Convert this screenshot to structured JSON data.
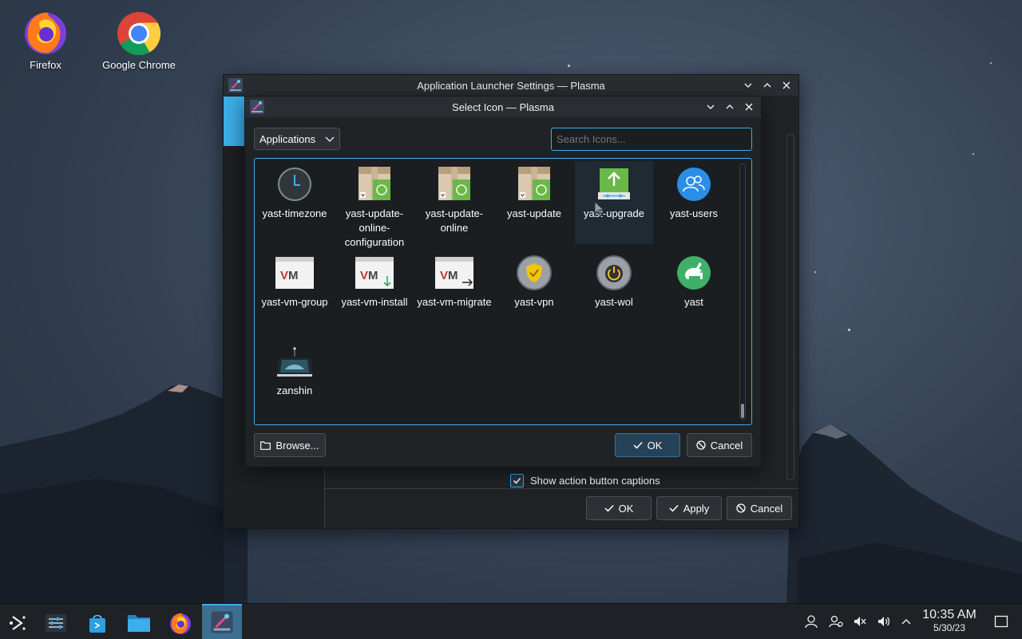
{
  "desktop": {
    "icons": [
      {
        "label": "Firefox"
      },
      {
        "label": "Google Chrome"
      }
    ]
  },
  "launcher_window": {
    "title": "Application Launcher Settings — Plasma",
    "show_captions_label": "Show action button captions",
    "show_captions_checked": true,
    "ok_label": "OK",
    "apply_label": "Apply",
    "cancel_label": "Cancel"
  },
  "dialog": {
    "title": "Select Icon — Plasma",
    "category": "Applications",
    "search_placeholder": "Search Icons...",
    "icons": [
      {
        "label": "yast-timezone",
        "icon": "clock-icon"
      },
      {
        "label": "yast-update-online-configuration",
        "icon": "package-update-icon"
      },
      {
        "label": "yast-update-online",
        "icon": "package-update-icon"
      },
      {
        "label": "yast-update",
        "icon": "package-update-icon"
      },
      {
        "label": "yast-upgrade",
        "icon": "upgrade-arrow-icon"
      },
      {
        "label": "yast-users",
        "icon": "users-icon"
      },
      {
        "label": "yast-vm-group",
        "icon": "vm-window-icon"
      },
      {
        "label": "yast-vm-install",
        "icon": "vm-install-icon"
      },
      {
        "label": "yast-vm-migrate",
        "icon": "vm-migrate-icon"
      },
      {
        "label": "yast-vpn",
        "icon": "vpn-shield-icon"
      },
      {
        "label": "yast-wol",
        "icon": "power-icon"
      },
      {
        "label": "yast",
        "icon": "yast-chameleon-icon"
      },
      {
        "label": "zanshin",
        "icon": "zanshin-icon"
      }
    ],
    "browse_label": "Browse...",
    "ok_label": "OK",
    "cancel_label": "Cancel"
  },
  "taskbar": {
    "time": "10:35 AM",
    "date": "5/30/23"
  },
  "colors": {
    "accent": "#3daee9",
    "window_bg": "#202326",
    "titlebar": "#2a2e32"
  }
}
